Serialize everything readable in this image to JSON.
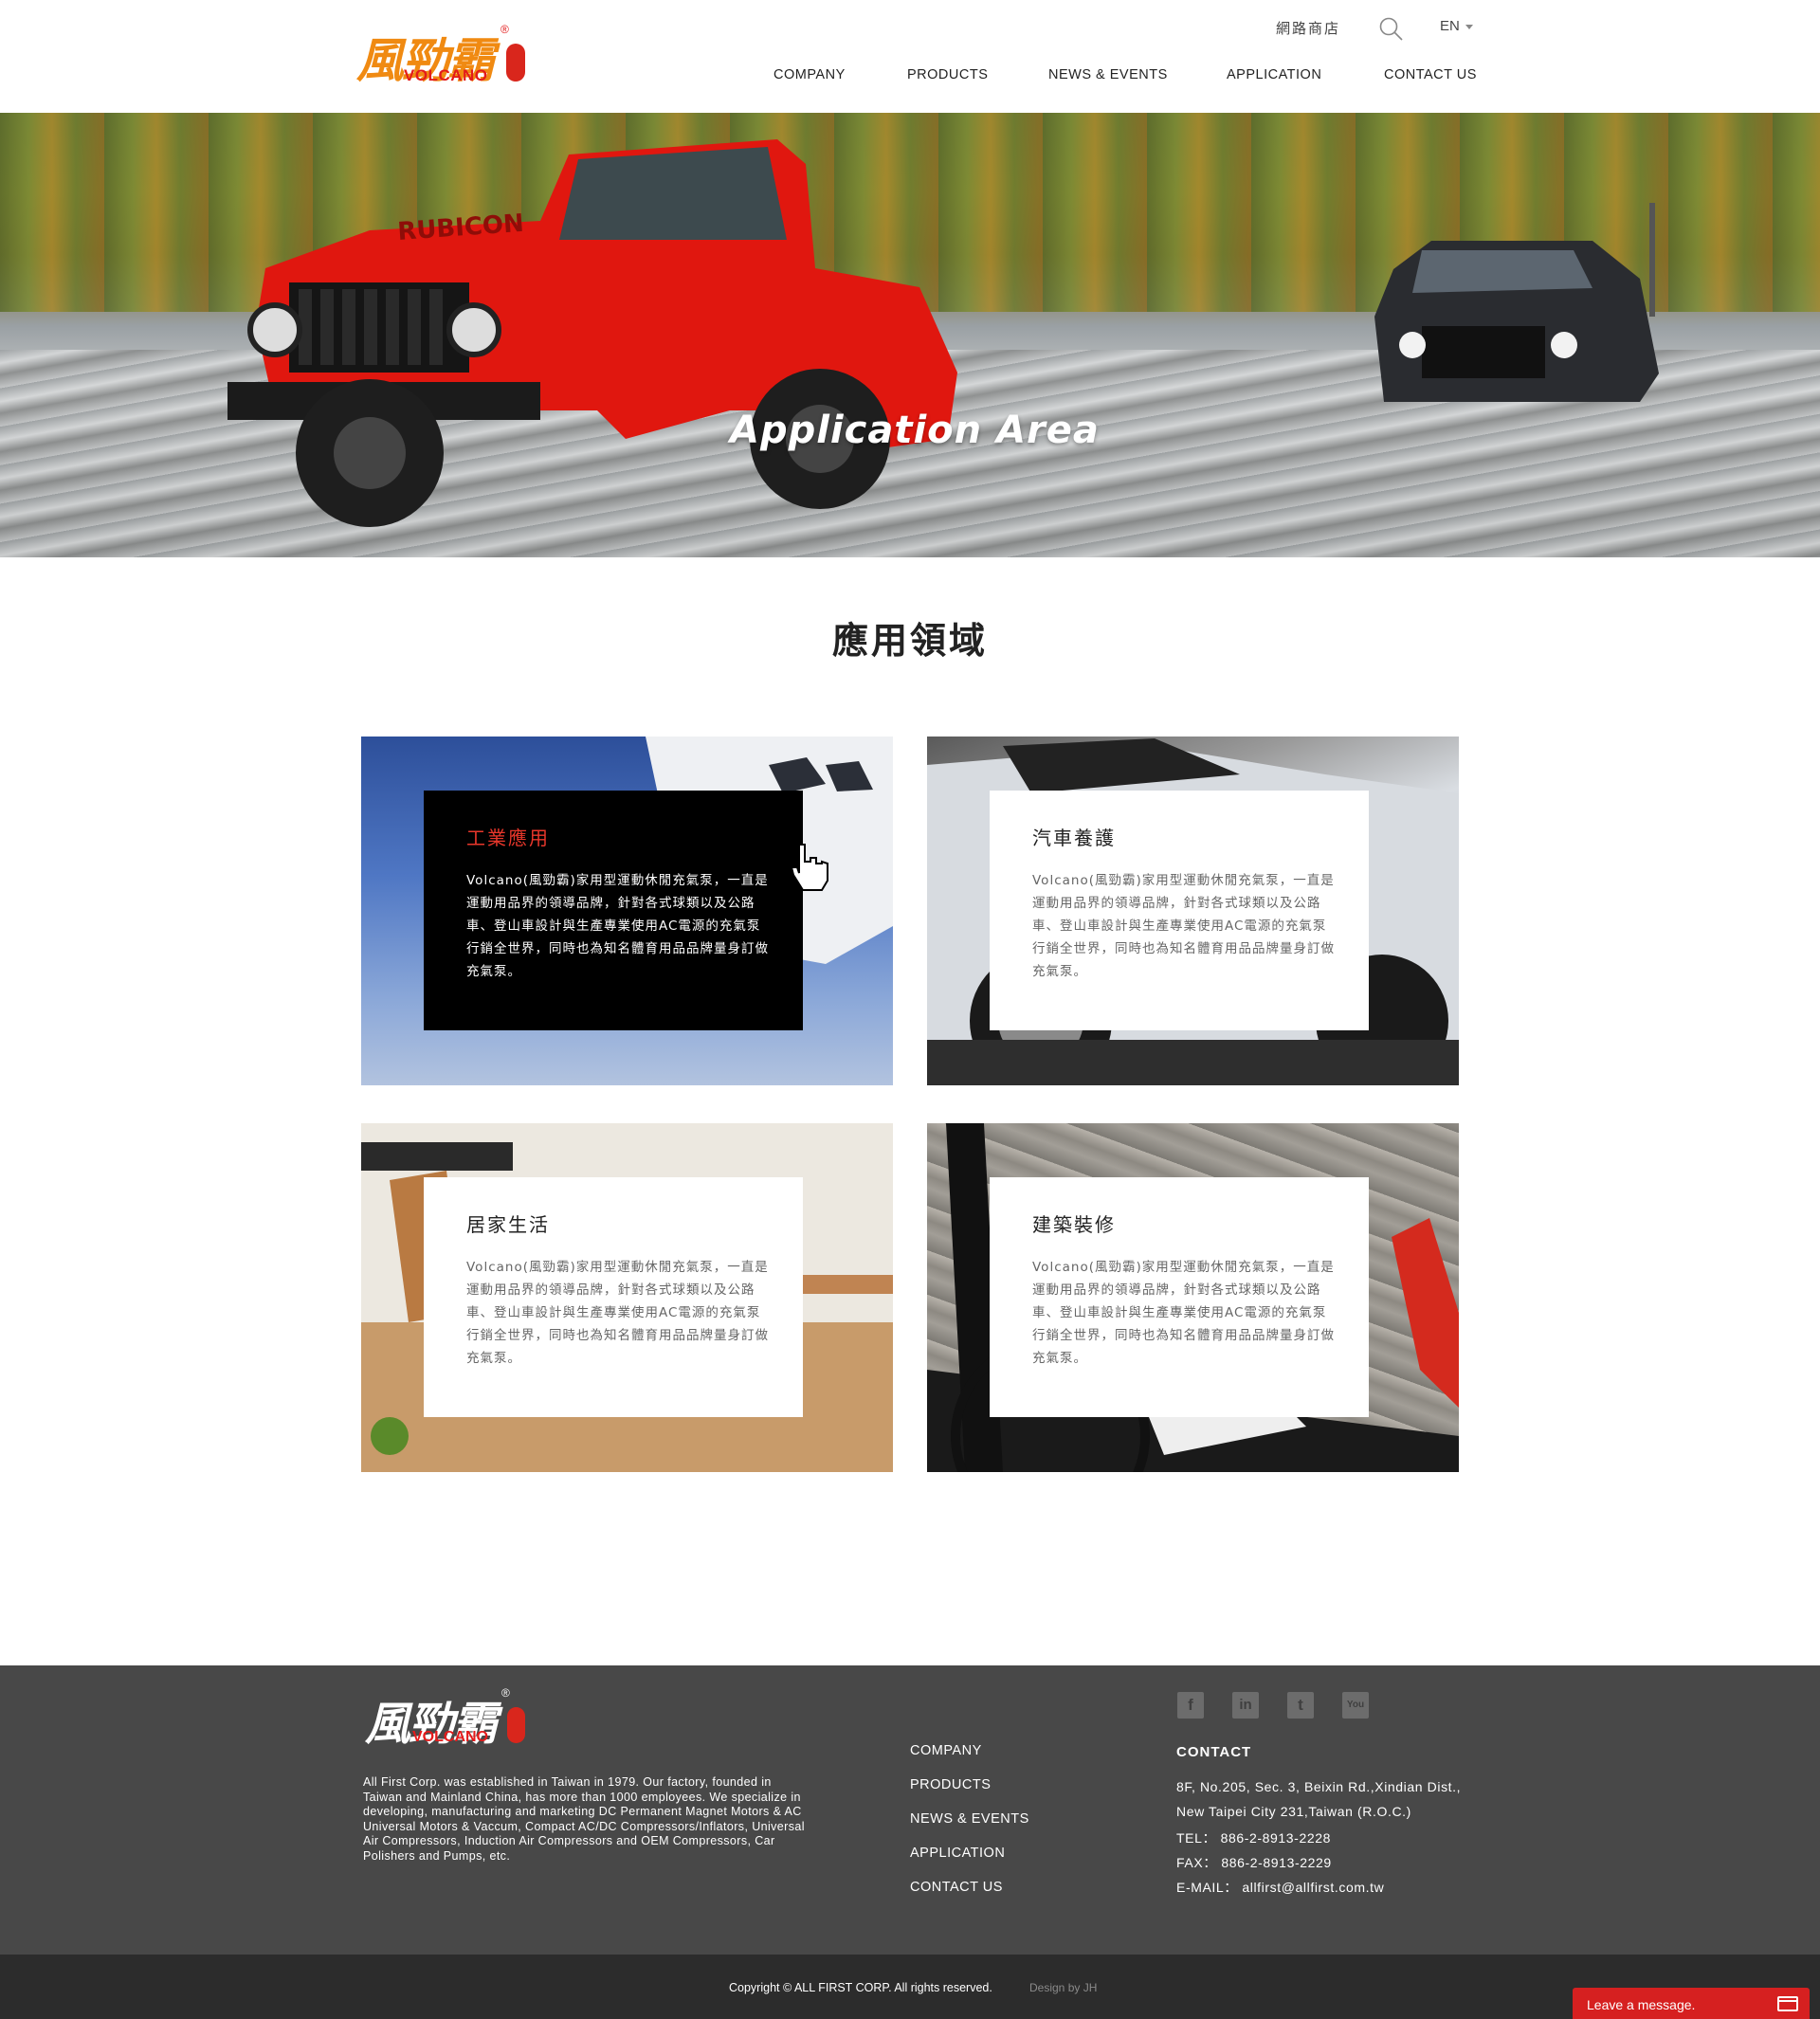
{
  "header": {
    "logo_cn": "風勁霸",
    "logo_en": "VOLCANO",
    "logo_reg": "®",
    "shop_label": "網路商店",
    "search_icon": "search-icon",
    "lang_label": "EN",
    "nav": [
      "COMPANY",
      "PRODUCTS",
      "NEWS & EVENTS",
      "APPLICATION",
      "CONTACT US"
    ]
  },
  "hero": {
    "title": "Application Area"
  },
  "section": {
    "title": "應用領域"
  },
  "cards": [
    {
      "title": "工業應用",
      "text": "Volcano(風勁霸)家用型運動休閒充氣泵，一直是運動用品界的領導品牌，針對各式球類以及公路車、登山車設計與生產專業使用AC電源的充氣泵行銷全世界，同時也為知名體育用品品牌量身訂做充氣泵。",
      "active": true
    },
    {
      "title": "汽車養護",
      "text": "Volcano(風勁霸)家用型運動休閒充氣泵，一直是運動用品界的領導品牌，針對各式球類以及公路車、登山車設計與生產專業使用AC電源的充氣泵行銷全世界，同時也為知名體育用品品牌量身訂做充氣泵。",
      "active": false
    },
    {
      "title": "居家生活",
      "text": "Volcano(風勁霸)家用型運動休閒充氣泵，一直是運動用品界的領導品牌，針對各式球類以及公路車、登山車設計與生產專業使用AC電源的充氣泵行銷全世界，同時也為知名體育用品品牌量身訂做充氣泵。",
      "active": false
    },
    {
      "title": "建築裝修",
      "text": "Volcano(風勁霸)家用型運動休閒充氣泵，一直是運動用品界的領導品牌，針對各式球類以及公路車、登山車設計與生產專業使用AC電源的充氣泵行銷全世界，同時也為知名體育用品品牌量身訂做充氣泵。",
      "active": false
    }
  ],
  "footer": {
    "logo_cn": "風勁霸",
    "logo_en": "VOLCANO",
    "logo_reg": "®",
    "about": "All First Corp. was established in Taiwan in 1979. Our factory, founded in Taiwan and Mainland China, has more than 1000 employees. We specialize in developing, manufacturing and marketing DC Permanent Magnet Motors & AC Universal Motors & Vaccum, Compact AC/DC Compressors/Inflators, Universal Air Compressors, Induction Air Compressors and OEM Compressors, Car Polishers and Pumps, etc.",
    "nav": [
      "COMPANY",
      "PRODUCTS",
      "NEWS & EVENTS",
      "APPLICATION",
      "CONTACT US"
    ],
    "social": [
      {
        "icon": "facebook-icon",
        "glyph": "f"
      },
      {
        "icon": "linkedin-icon",
        "glyph": "in"
      },
      {
        "icon": "twitter-icon",
        "glyph": "t"
      },
      {
        "icon": "youtube-icon",
        "glyph": "You"
      }
    ],
    "contact_title": "CONTACT",
    "address_1": "8F, No.205, Sec. 3, Beixin Rd.,Xindian Dist.,",
    "address_2": "New Taipei City 231,Taiwan (R.O.C.)",
    "tel": "TEL： 886-2-8913-2228",
    "fax": "FAX： 886-2-8913-2229",
    "email": "E-MAIL： allfirst@allfirst.com.tw"
  },
  "bottom": {
    "copyright": "Copyright © ALL FIRST CORP. All rights reserved.",
    "design": "Design by JH",
    "leave_message": "Leave a message.",
    "message_icon": "message-window-icon"
  },
  "colors": {
    "brand_orange": "#f08a12",
    "brand_red": "#e31b1b",
    "active_title_red": "#e8372b",
    "footer_bg": "#484848",
    "bottom_bg": "#2c2c2c",
    "chat_red": "#d62020"
  }
}
